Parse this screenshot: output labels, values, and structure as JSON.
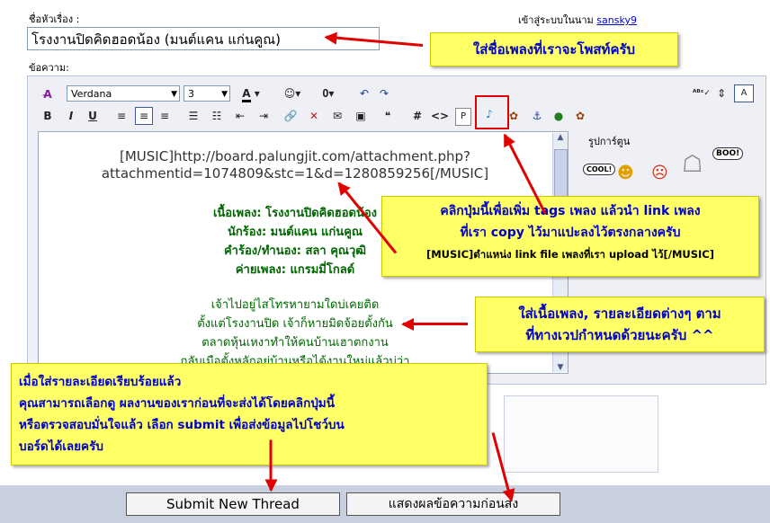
{
  "form": {
    "title_label": "ชื่อหัวเรื่อง :",
    "logged_in_text": "เข้าสู่ระบบในนาม",
    "username": "sansky9",
    "title_value": "โรงงานปิดคิดฮอดน้อง (มนต์แคน แก่นคูณ)",
    "message_label": "ข้อความ:"
  },
  "toolbar": {
    "font": "Verdana",
    "size": "3",
    "color_letter": "A",
    "bold": "B",
    "italic": "I",
    "underline": "U",
    "code": "#",
    "html": "<>",
    "smilies_title": "รูปการ์ตูน"
  },
  "editor": {
    "music_line1": "[MUSIC]http://board.palungjit.com/attachment.php?",
    "music_line2": "attachmentid=1074809&stc=1&d=1280859256[/MUSIC]",
    "song_name": "เนื้อเพลง: โรงงานปิดคิดฮอดน้อง",
    "singer": "นักร้อง: มนต์แคน แก่นคูณ",
    "writer": "คำร้อง/ทำนอง: สลา คุณวุฒิ",
    "label_co": "ค่ายเพลง: แกรมมี่โกลด์",
    "lyric1": "เจ้าไปอยู่ไสโทรหายามใดบ่เคยติด",
    "lyric2": "ตั้งแต่โรงงานปิด เจ้าก็หายมิดจ้อยตั้งกัน",
    "lyric3": "ตลาดหุ้นเหงาทำให้คนบ้านเฮาตกงาน",
    "lyric4": "กลับเมือตั้งหลักอยู่บ้านหรือได้งานใหม่แล้วบ่ว่า"
  },
  "callouts": {
    "title_tip": "ใส่ชื่อเพลงที่เราจะโพสท์ครับ",
    "tags_tip_line1": "คลิกปุ่มนี้เพื่อเพิ่ม tags เพลง แล้วนำ link เพลง",
    "tags_tip_line2": "ที่เรา copy ไว้มาแปะลงไว้ตรงกลางครับ",
    "tags_tip_line3": "[MUSIC]ตำแหน่ง link file เพลงที่เรา upload ไว้[/MUSIC]",
    "lyrics_tip_line1": "ใส่เนื้อเพลง, รายละเอียดต่างๆ ตาม",
    "lyrics_tip_line2": "ที่ทางเวปกำหนดด้วยนะครับ ^^",
    "submit_tip_line1": "เมื่อใส่รายละเอียดเรียบร้อยแล้ว",
    "submit_tip_line2": "คุณสามารถเลือกดู ผลงานของเราก่อนที่จะส่งได้โดยคลิกปุ่มนี้",
    "submit_tip_line3": "หรือตรวจสอบมั่นใจแล้ว เลือก submit เพื่อส่งข้อมูลไปโชว์บน",
    "submit_tip_line4": "บอร์ดได้เลยครับ"
  },
  "buttons": {
    "submit": "Submit New Thread",
    "preview": "แสดงผลข้อความก่อนส่ง"
  },
  "smilies": {
    "cool": "COOL!",
    "boo": "BOO!"
  },
  "colors": {
    "callout_bg": "#ffff66",
    "callout_text": "#0000cc",
    "arrow": "#e00000",
    "lyric_green": "#006600"
  }
}
